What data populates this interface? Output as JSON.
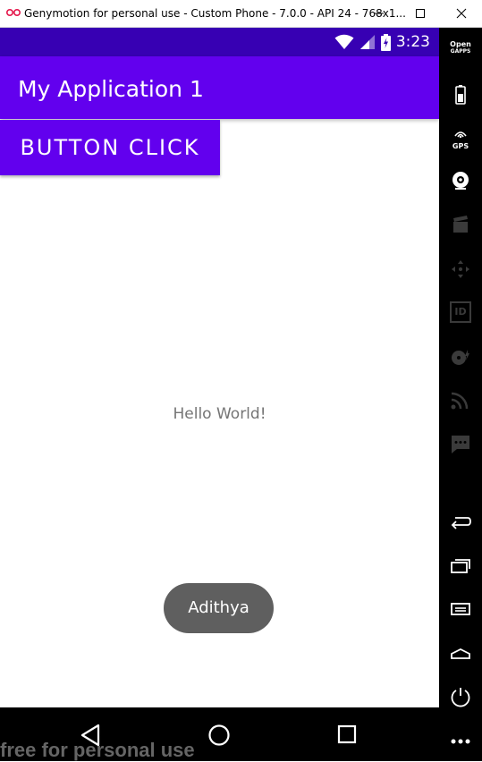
{
  "window": {
    "title": "Genymotion for personal use - Custom Phone - 7.0.0 - API 24 - 768x1...",
    "logo_icon": "genymotion-logo-icon",
    "controls": [
      "minimize-icon",
      "maximize-icon",
      "close-icon"
    ]
  },
  "statusbar": {
    "time": "3:23",
    "icons": [
      "wifi-icon",
      "cell-signal-icon",
      "battery-charging-icon"
    ]
  },
  "appbar": {
    "title": "My Application 1"
  },
  "main": {
    "button_label": "BUTTON CLICK",
    "hello_text": "Hello World!",
    "toast_text": "Adithya"
  },
  "navbar": {
    "buttons": [
      "back-icon",
      "home-icon",
      "recents-icon"
    ],
    "watermark": "free for personal use"
  },
  "sidebar": {
    "opengapps_line1": "Open",
    "opengapps_line2": "GAPPS",
    "gps_label": "GPS",
    "id_label": "ID",
    "items": [
      "opengapps-icon",
      "battery-icon",
      "gps-icon",
      "webcam-icon",
      "media-icon",
      "dpad-icon",
      "device-id-icon",
      "disk-io-icon",
      "cast-icon",
      "sms-icon",
      "back-icon",
      "recent-apps-icon",
      "menu-icon",
      "home-icon",
      "power-icon",
      "more-icon"
    ]
  },
  "colors": {
    "statusbar": "#3700b3",
    "primary": "#6200ee",
    "toast": "#5f5f5f",
    "hello_text": "#757575"
  }
}
